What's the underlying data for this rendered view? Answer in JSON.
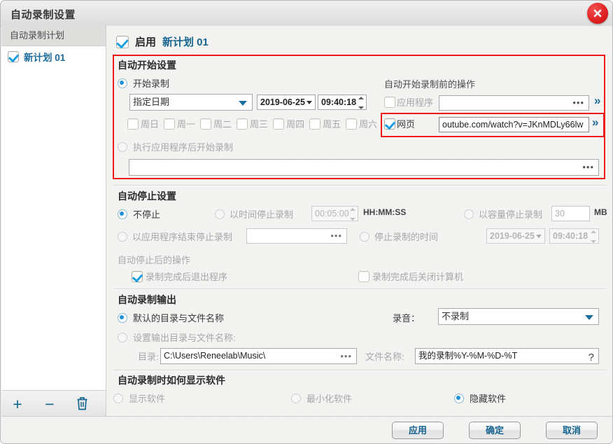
{
  "window": {
    "title": "自动录制设置",
    "close_icon": "close-icon"
  },
  "sidebar": {
    "header": "自动录制计划",
    "plans": [
      {
        "label": "新计划 01",
        "checked": true
      }
    ],
    "toolbar": {
      "add": "+",
      "remove": "−",
      "delete": "trash-icon"
    }
  },
  "main": {
    "enable": {
      "label_prefix": "启用",
      "plan_name": "新计划 01",
      "checked": true
    },
    "start_section": {
      "title": "自动开始设置",
      "start_record_radio": "开始录制",
      "date_mode": "指定日期",
      "date": "2019-06-25",
      "time": "09:40:18",
      "weekdays": [
        "周日",
        "周一",
        "周二",
        "周三",
        "周四",
        "周五",
        "周六"
      ],
      "pre_action_title": "自动开始录制前的操作",
      "app_checkbox": "应用程序",
      "app_value": "",
      "web_checkbox": "网页",
      "web_value": "outube.com/watch?v=JKnMDLy66lw",
      "after_app_radio": "执行应用程序后开始录制",
      "after_app_value": ""
    },
    "stop_section": {
      "title": "自动停止设置",
      "no_stop": "不停止",
      "by_time": "以时间停止录制",
      "by_time_value": "00:05:00",
      "by_time_format": "HH:MM:SS",
      "by_size": "以容量停止录制",
      "by_size_value": "30",
      "by_size_unit": "MB",
      "by_app_end": "以应用程序结束停止录制",
      "by_app_end_value": "",
      "stop_at_time": "停止录制的时间",
      "stop_date": "2019-06-25",
      "stop_time": "09:40:18",
      "after_stop_title": "自动停止后的操作",
      "exit_program": "录制完成后退出程序",
      "shutdown_pc": "录制完成后关闭计算机"
    },
    "output_section": {
      "title": "自动录制输出",
      "default_path": "默认的目录与文件名称",
      "custom_path": "设置输出目录与文件名称:",
      "dir_label": "目录:",
      "dir_value": "C:\\Users\\Reneelab\\Music\\",
      "filename_label": "文件名称:",
      "filename_value": "我的录制%Y-%M-%D-%T",
      "audio_label": "录音：",
      "audio_value": "不录制",
      "help": "?"
    },
    "display_section": {
      "title": "自动录制时如何显示软件",
      "options": [
        "显示软件",
        "最小化软件",
        "隐藏软件"
      ],
      "selected": 2
    }
  },
  "footer": {
    "apply": "应用",
    "ok": "确定",
    "cancel": "取消"
  },
  "colors": {
    "accent": "#15658f",
    "highlight": "#f01818",
    "check": "#1a9fe0"
  }
}
